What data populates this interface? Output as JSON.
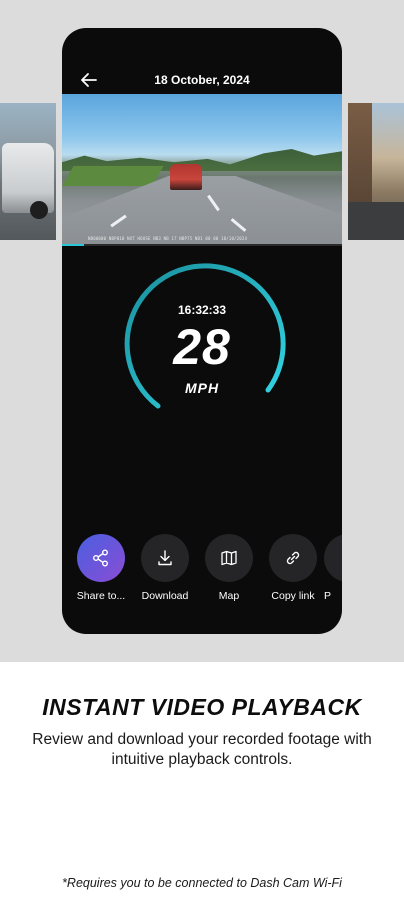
{
  "screen": {
    "title": "18 October, 2024",
    "back_icon": "arrow-left-icon"
  },
  "video": {
    "timestamp_overlay": "NB00000 NBP010   NXT HOUSE NB3 NB 17   NBP75 NB1 00 00   18/10/2024",
    "progress_percent": 8
  },
  "telemetry": {
    "time": "16:32:33",
    "speed": "28",
    "unit": "MPH"
  },
  "actions": [
    {
      "label": "Share to...",
      "icon": "share-icon"
    },
    {
      "label": "Download",
      "icon": "download-icon"
    },
    {
      "label": "Map",
      "icon": "map-icon"
    },
    {
      "label": "Copy link",
      "icon": "link-icon"
    },
    {
      "label": "P",
      "icon": "more-icon"
    }
  ],
  "promo": {
    "headline": "INSTANT VIDEO PLAYBACK",
    "subtitle": "Review and download your recorded footage with intuitive playback controls.",
    "footnote": "*Requires you to be connected to Dash Cam Wi-Fi"
  },
  "colors": {
    "accent": "#2cc7d6",
    "share_gradient_start": "#4a5fe0",
    "share_gradient_end": "#8a4dd6"
  }
}
